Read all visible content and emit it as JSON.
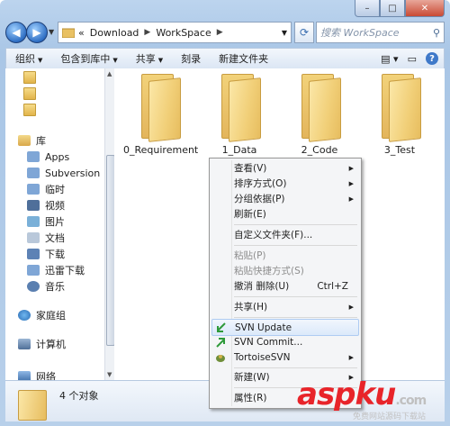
{
  "window": {
    "caption": {
      "minimize": "–",
      "maximize": "□",
      "close": "✕"
    }
  },
  "address": {
    "prefix": "«",
    "segments": [
      "Download",
      "WorkSpace"
    ],
    "search_placeholder": "搜索 WorkSpace"
  },
  "toolbar": {
    "organize": "组织",
    "include_library": "包含到库中",
    "share": "共享",
    "burn": "刻录",
    "new_folder": "新建文件夹"
  },
  "nav": {
    "library": "库",
    "items": [
      "Apps",
      "Subversion",
      "临时",
      "视频",
      "图片",
      "文档",
      "下载",
      "迅雷下载",
      "音乐"
    ],
    "homegroup": "家庭组",
    "computer": "计算机",
    "network": "网络"
  },
  "folders": [
    "0_Requirement",
    "1_Data",
    "2_Code",
    "3_Test"
  ],
  "status": {
    "count": "4 个对象"
  },
  "context_menu": {
    "view": "查看(V)",
    "sort": "排序方式(O)",
    "group": "分组依据(P)",
    "refresh": "刷新(E)",
    "customize": "自定义文件夹(F)...",
    "paste": "粘贴(P)",
    "paste_shortcut": "粘贴快捷方式(S)",
    "undo_delete": "撤消 删除(U)",
    "undo_shortcut": "Ctrl+Z",
    "share": "共享(H)",
    "svn_update": "SVN Update",
    "svn_commit": "SVN Commit...",
    "tortoise": "TortoiseSVN",
    "new": "新建(W)",
    "properties": "属性(R)"
  },
  "watermark": {
    "logo": "aspku",
    "tld": ".com",
    "sub": "免费网站源码下载站"
  }
}
